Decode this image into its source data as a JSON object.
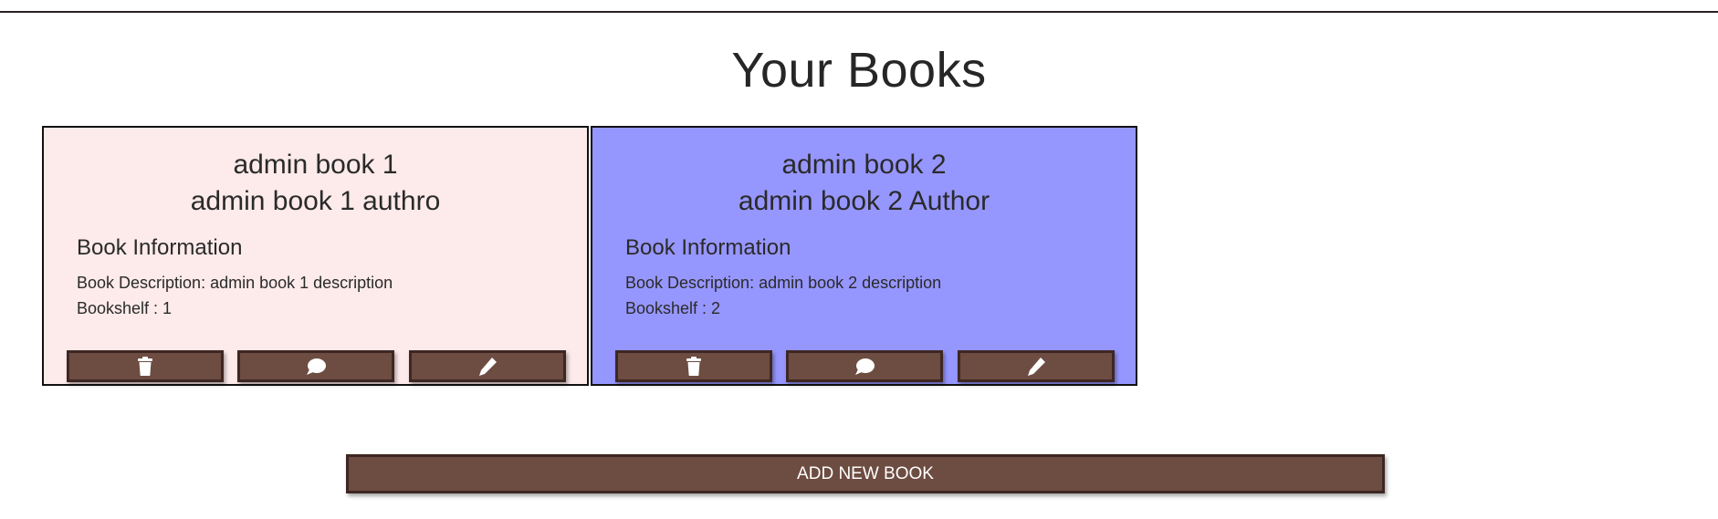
{
  "page": {
    "title": "Your Books"
  },
  "books": [
    {
      "title": "admin book 1",
      "author": "admin book 1 authro",
      "info_heading": "Book Information",
      "description": "Book Description: admin book 1 description",
      "bookshelf": "Bookshelf : 1",
      "bg_color": "#fdeaea"
    },
    {
      "title": "admin book 2",
      "author": "admin book 2 Author",
      "info_heading": "Book Information",
      "description": "Book Description: admin book 2 description",
      "bookshelf": "Bookshelf : 2",
      "bg_color": "#9696ff"
    }
  ],
  "card_actions": [
    "trash-icon",
    "comment-icon",
    "pencil-icon"
  ],
  "add_button": {
    "label": "ADD NEW BOOK"
  },
  "colors": {
    "button": "#6d4c41",
    "button_border": "#3e2723"
  }
}
